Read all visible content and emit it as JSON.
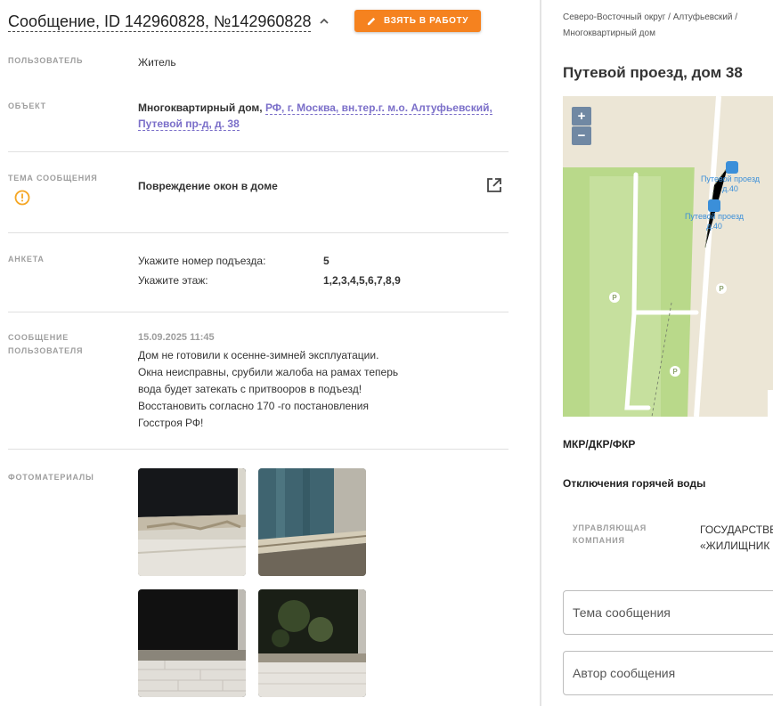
{
  "header": {
    "title": "Сообщение, ID 142960828, №142960828",
    "take_button": "ВЗЯТЬ В РАБОТУ"
  },
  "details": {
    "user": {
      "label": "ПОЛЬЗОВАТЕЛЬ",
      "value": "Житель"
    },
    "object": {
      "label": "ОБЪЕКТ",
      "type": "Многоквартирный дом,",
      "address_line1": "РФ, г. Москва, вн.тер.г. м.о. Алтуфьевский,",
      "address_line2": "Путевой пр-д, д. 38"
    },
    "topic": {
      "label": "ТЕМА СООБЩЕНИЯ",
      "value": "Повреждение окон в доме"
    },
    "survey": {
      "label": "АНКЕТА",
      "rows": [
        {
          "question": "Укажите номер подъезда:",
          "answer": "5"
        },
        {
          "question": "Укажите этаж:",
          "answer": "1,2,3,4,5,6,7,8,9"
        }
      ]
    },
    "user_message": {
      "label_line1": "СООБЩЕНИЕ",
      "label_line2": "ПОЛЬЗОВАТЕЛЯ",
      "date": "15.09.2025 11:45",
      "lines": [
        "Дом не готовили к осенне-зимней эксплуатации.",
        "Окна неисправны, срубили жалоба на рамах теперь",
        "вода будет затекать с притвооров в подъезд!",
        "Восстановить согласно 170 -го постановления",
        "Госстроя РФ!"
      ]
    },
    "photos": {
      "label": "ФОТОМАТЕРИАЛЫ",
      "count": 4
    }
  },
  "side": {
    "breadcrumb_line1": "Северо-Восточный округ / Алтуфьевский /",
    "breadcrumb_line2": "Многоквартирный дом",
    "address_title": "Путевой проезд, дом 38",
    "map": {
      "zoom_in": "+",
      "zoom_out": "−",
      "stop1_line1": "Путевой проезд",
      "stop1_line2": "д.40",
      "stop2_line1": "Путевой проезд",
      "stop2_line2": "д.40",
      "parking": "P"
    },
    "mkr_label": "МКР/ДКР/ФКР",
    "hot_water_label": "Отключения горячей воды",
    "management": {
      "label_line1": "УПРАВЛЯЮЩАЯ",
      "label_line2": "КОМПАНИЯ",
      "value_line1": "ГОСУДАРСТВЕ",
      "value_line2": "«ЖИЛИЩНИК"
    },
    "topic_placeholder": "Тема сообщения",
    "author_placeholder": "Автор сообщения"
  },
  "colors": {
    "accent": "#f5821f",
    "link": "#7b6fc9",
    "warning": "#f5a623",
    "map_green": "#b9d98a",
    "map_sand": "#ece6d6",
    "zoom_button": "#7088a3"
  }
}
